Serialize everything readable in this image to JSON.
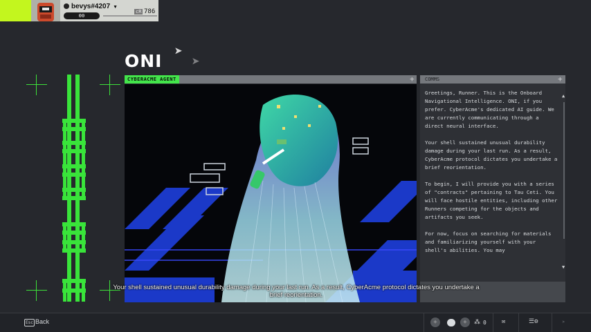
{
  "user": {
    "name": "bevys#4207",
    "level": "00",
    "credits_label": "cR",
    "credits": "786"
  },
  "page": {
    "title": "ONI"
  },
  "agent": {
    "tag": "CYBERACME AGENT"
  },
  "comms": {
    "label": "COMMS",
    "paragraphs": [
      "Greetings, Runner. This is the Onboard Navigational Intelligence. ONI, if you prefer. CyberAcme's dedicated AI guide. We are currently communicating through a direct neural interface.",
      "Your shell sustained unusual durability damage during your last run. As a result, CyberAcme protocol dictates you undertake a brief reorientation.",
      "To begin, I will provide you with a series of \"contracts\" pertaining to Tau Ceti. You will face hostile entities, including other Runners competing for the objects and artifacts you seek.",
      "For now, focus on searching for materials and familiarizing yourself with your shell's abilities. You may"
    ]
  },
  "subtitle": {
    "line1": "Your shell sustained unusual durability damage during your last run. As a result, CyberAcme protocol dictates you undertake a",
    "line2": "brief reorientation."
  },
  "bottom_bar": {
    "esc_key": "Esc",
    "back_label": "Back",
    "party_count": "0"
  },
  "colors": {
    "accent_green": "#43e54b",
    "lime": "#c3f61e",
    "background": "#26282d",
    "panel": "#2e3035"
  }
}
